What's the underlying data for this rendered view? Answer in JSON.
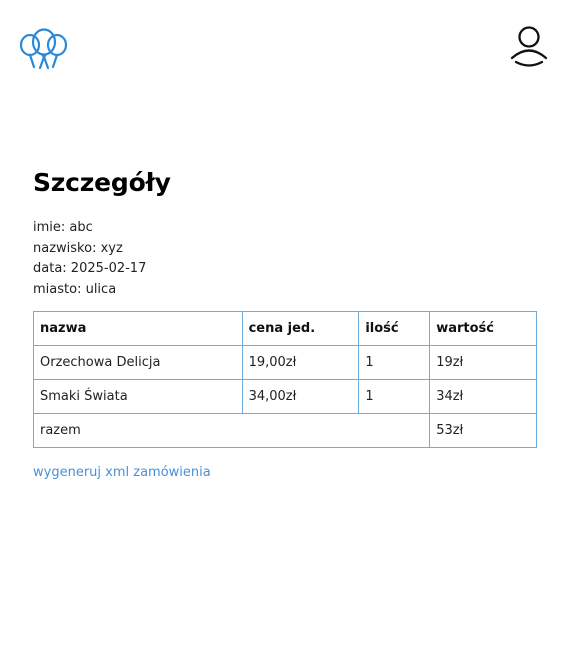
{
  "header": {
    "logo_icon": "balloons-icon",
    "user_icon": "user-icon",
    "accent_color": "#2a8ad9"
  },
  "main": {
    "title": "Szczegóły",
    "details": [
      {
        "label": "imie: abc"
      },
      {
        "label": "nazwisko: xyz"
      },
      {
        "label": "data: 2025-02-17"
      },
      {
        "label": "miasto: ulica"
      }
    ],
    "table": {
      "headers": [
        "nazwa",
        "cena jed.",
        "ilość",
        "wartość"
      ],
      "rows": [
        [
          "Orzechowa Delicja",
          "19,00zł",
          "1",
          "19zł"
        ],
        [
          "Smaki Świata",
          "34,00zł",
          "1",
          "34zł"
        ]
      ],
      "total_label": "razem",
      "total_value": "53zł"
    },
    "xml_link": "wygeneruj xml zamówienia"
  }
}
